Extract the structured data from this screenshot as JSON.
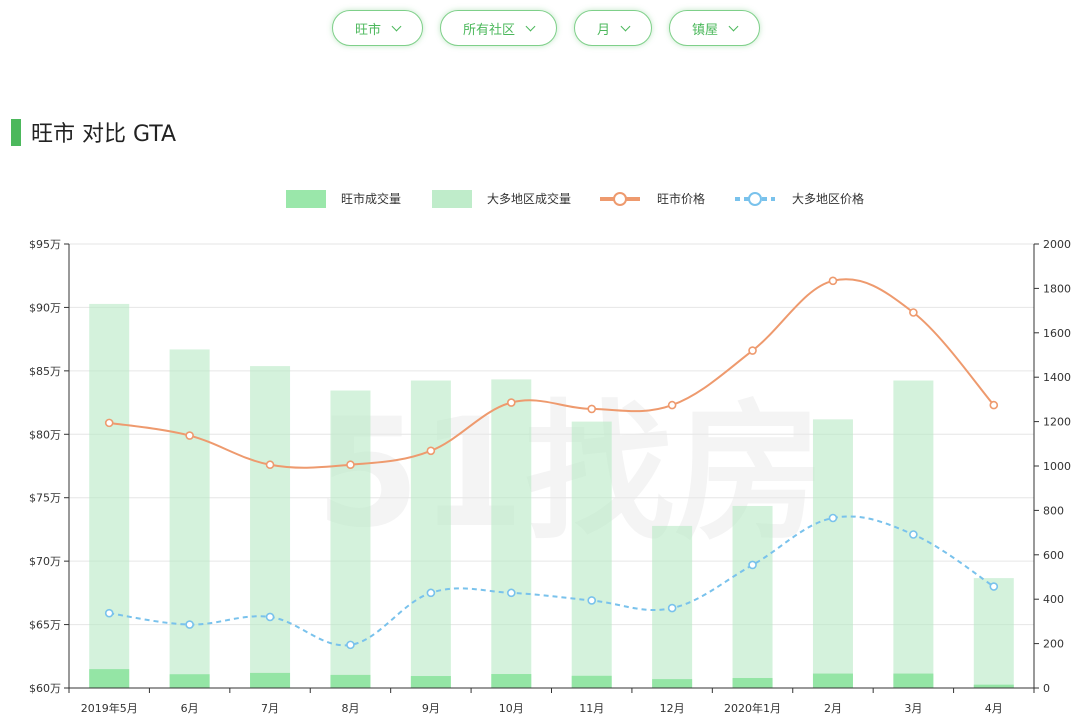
{
  "filters": [
    {
      "label": "旺市"
    },
    {
      "label": "所有社区"
    },
    {
      "label": "月"
    },
    {
      "label": "镇屋"
    }
  ],
  "section": {
    "title": "旺市 对比 GTA"
  },
  "watermark": "51找房",
  "colors": {
    "accent": "#4cb85c",
    "local_volume": "#88e39b",
    "gta_volume": "#b8eac4",
    "local_price": "#ee9a6e",
    "gta_price": "#79c2ec"
  },
  "chart_data": {
    "type": "bar",
    "categories": [
      "2019年5月",
      "6月",
      "7月",
      "8月",
      "9月",
      "10月",
      "11月",
      "12月",
      "2020年1月",
      "2月",
      "3月",
      "4月"
    ],
    "left_axis": {
      "min": 60,
      "max": 95,
      "step": 5,
      "tick_format": "${v}万"
    },
    "right_axis": {
      "min": 0,
      "max": 2000,
      "step": 200
    },
    "legend": {
      "placement": "top-center"
    },
    "grid": true,
    "series": [
      {
        "name": "旺市成交量",
        "type": "bar",
        "axis": "right",
        "values": [
          85,
          62,
          68,
          59,
          54,
          63,
          55,
          40,
          45,
          65,
          65,
          15
        ]
      },
      {
        "name": "大多地区成交量",
        "type": "bar",
        "axis": "right",
        "values": [
          1730,
          1525,
          1450,
          1340,
          1385,
          1390,
          1200,
          730,
          820,
          1210,
          1385,
          495
        ]
      },
      {
        "name": "旺市价格",
        "type": "line",
        "axis": "left",
        "values": [
          80.9,
          79.9,
          77.6,
          77.6,
          78.7,
          82.5,
          82.0,
          82.3,
          86.6,
          92.1,
          89.6,
          82.3
        ]
      },
      {
        "name": "大多地区价格",
        "type": "line",
        "axis": "left",
        "dashed": true,
        "values": [
          65.9,
          65.0,
          65.6,
          63.4,
          67.5,
          67.5,
          66.9,
          66.3,
          69.7,
          73.4,
          72.1,
          68.0
        ]
      }
    ]
  }
}
